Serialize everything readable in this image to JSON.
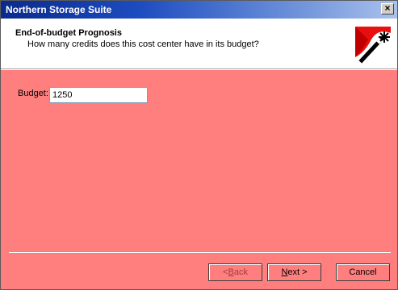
{
  "window": {
    "title": "Northern Storage Suite",
    "close_glyph": "×"
  },
  "header": {
    "title": "End-of-budget Prognosis",
    "subtitle": "How many credits does this cost center have in its budget?",
    "icon": "wizard-wand-icon"
  },
  "form": {
    "budget_label": "Budget:",
    "budget_value": "1250"
  },
  "buttons": {
    "back": {
      "pre": "< ",
      "mnemonic": "B",
      "post": "ack",
      "enabled": false
    },
    "next": {
      "pre": "",
      "mnemonic": "N",
      "post": "ext >",
      "enabled": true
    },
    "cancel": {
      "label": "Cancel",
      "enabled": true
    }
  },
  "colors": {
    "background": "#ff7f7f",
    "title_bar_start": "#0a2a8c",
    "title_bar_end": "#a9c1ec",
    "header_background": "#ffffff"
  }
}
